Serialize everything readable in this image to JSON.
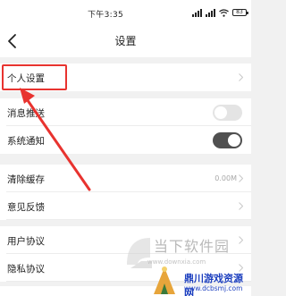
{
  "status_bar": {
    "time": "下午3:35",
    "battery": "83"
  },
  "nav": {
    "title": "设置"
  },
  "rows": [
    {
      "label": "个人设置",
      "value": "",
      "control": "chevron"
    },
    {
      "label": "消息推送",
      "value": "",
      "control": "toggle",
      "on": false
    },
    {
      "label": "系统通知",
      "value": "",
      "control": "toggle",
      "on": true
    },
    {
      "label": "清除缓存",
      "value": "0.00M",
      "control": "chevron"
    },
    {
      "label": "意见反馈",
      "value": "",
      "control": "chevron"
    },
    {
      "label": "用户协议",
      "value": "",
      "control": "chevron"
    },
    {
      "label": "隐私协议",
      "value": "",
      "control": "chevron"
    }
  ],
  "watermarks": {
    "downxia_text": "当下软件园",
    "downxia_url": "www.downxia.com",
    "badge_title": "鼎川游戏资源网",
    "badge_url": "www.dcbsmj.com"
  },
  "colors": {
    "highlight_red": "#e8332f",
    "toggle_on": "#505050",
    "toggle_off": "#e4e4e4",
    "badge_blue": "#1c3fbf"
  }
}
